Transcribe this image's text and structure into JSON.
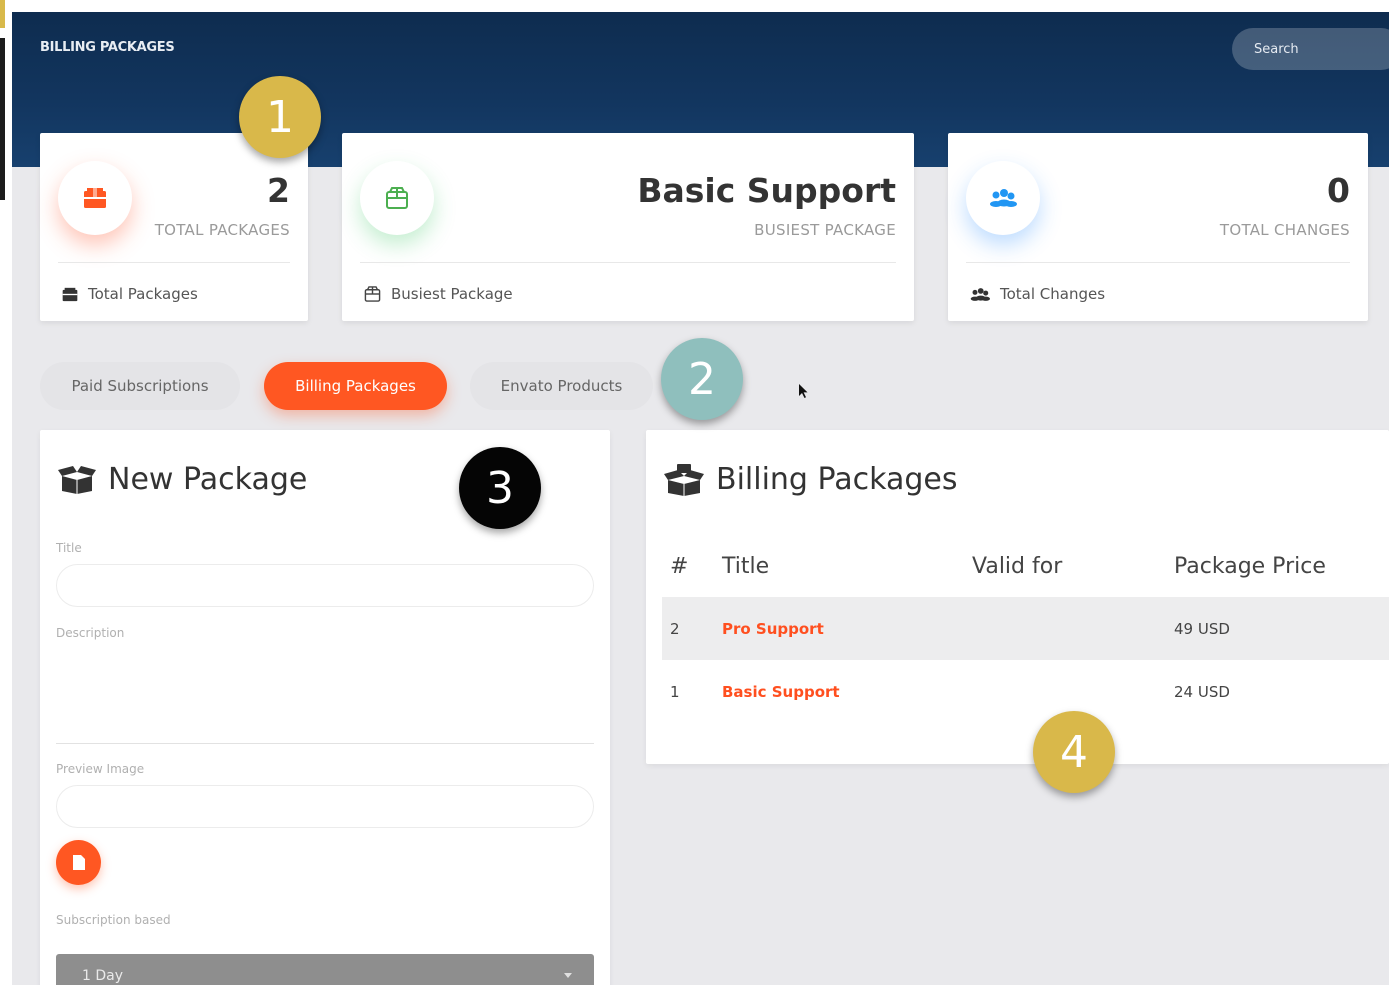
{
  "header": {
    "title": "BILLING PACKAGES",
    "search_placeholder": "Search"
  },
  "stats": [
    {
      "value": "2",
      "label": "TOTAL PACKAGES",
      "footer": "Total Packages",
      "icon": "package-icon",
      "color": "#ff5722"
    },
    {
      "value": "Basic Support",
      "label": "BUSIEST PACKAGE",
      "footer": "Busiest Package",
      "icon": "box-outline-icon",
      "color": "#4caf50"
    },
    {
      "value": "0",
      "label": "TOTAL CHANGES",
      "footer": "Total Changes",
      "icon": "users-icon",
      "color": "#2196f3"
    }
  ],
  "tabs": [
    {
      "label": "Paid Subscriptions",
      "active": false
    },
    {
      "label": "Billing Packages",
      "active": true
    },
    {
      "label": "Envato Products",
      "active": false
    }
  ],
  "new_package": {
    "title": "New Package",
    "fields": {
      "title_label": "Title",
      "description_label": "Description",
      "preview_label": "Preview Image",
      "subscription_label": "Subscription based",
      "subscription_value": "1 Day"
    }
  },
  "billing_packages": {
    "title": "Billing Packages",
    "columns": [
      "#",
      "Title",
      "Valid for",
      "Package Price"
    ],
    "rows": [
      {
        "id": "2",
        "title": "Pro Support",
        "valid_for": "",
        "price": "49 USD"
      },
      {
        "id": "1",
        "title": "Basic Support",
        "valid_for": "",
        "price": "24 USD"
      }
    ]
  },
  "badges": [
    "1",
    "2",
    "3",
    "4"
  ],
  "colors": {
    "accent": "#ff5722",
    "header": "#12355e",
    "badge_gold": "#d9b84a",
    "badge_teal": "#8fbfbd",
    "badge_black": "#050505"
  }
}
